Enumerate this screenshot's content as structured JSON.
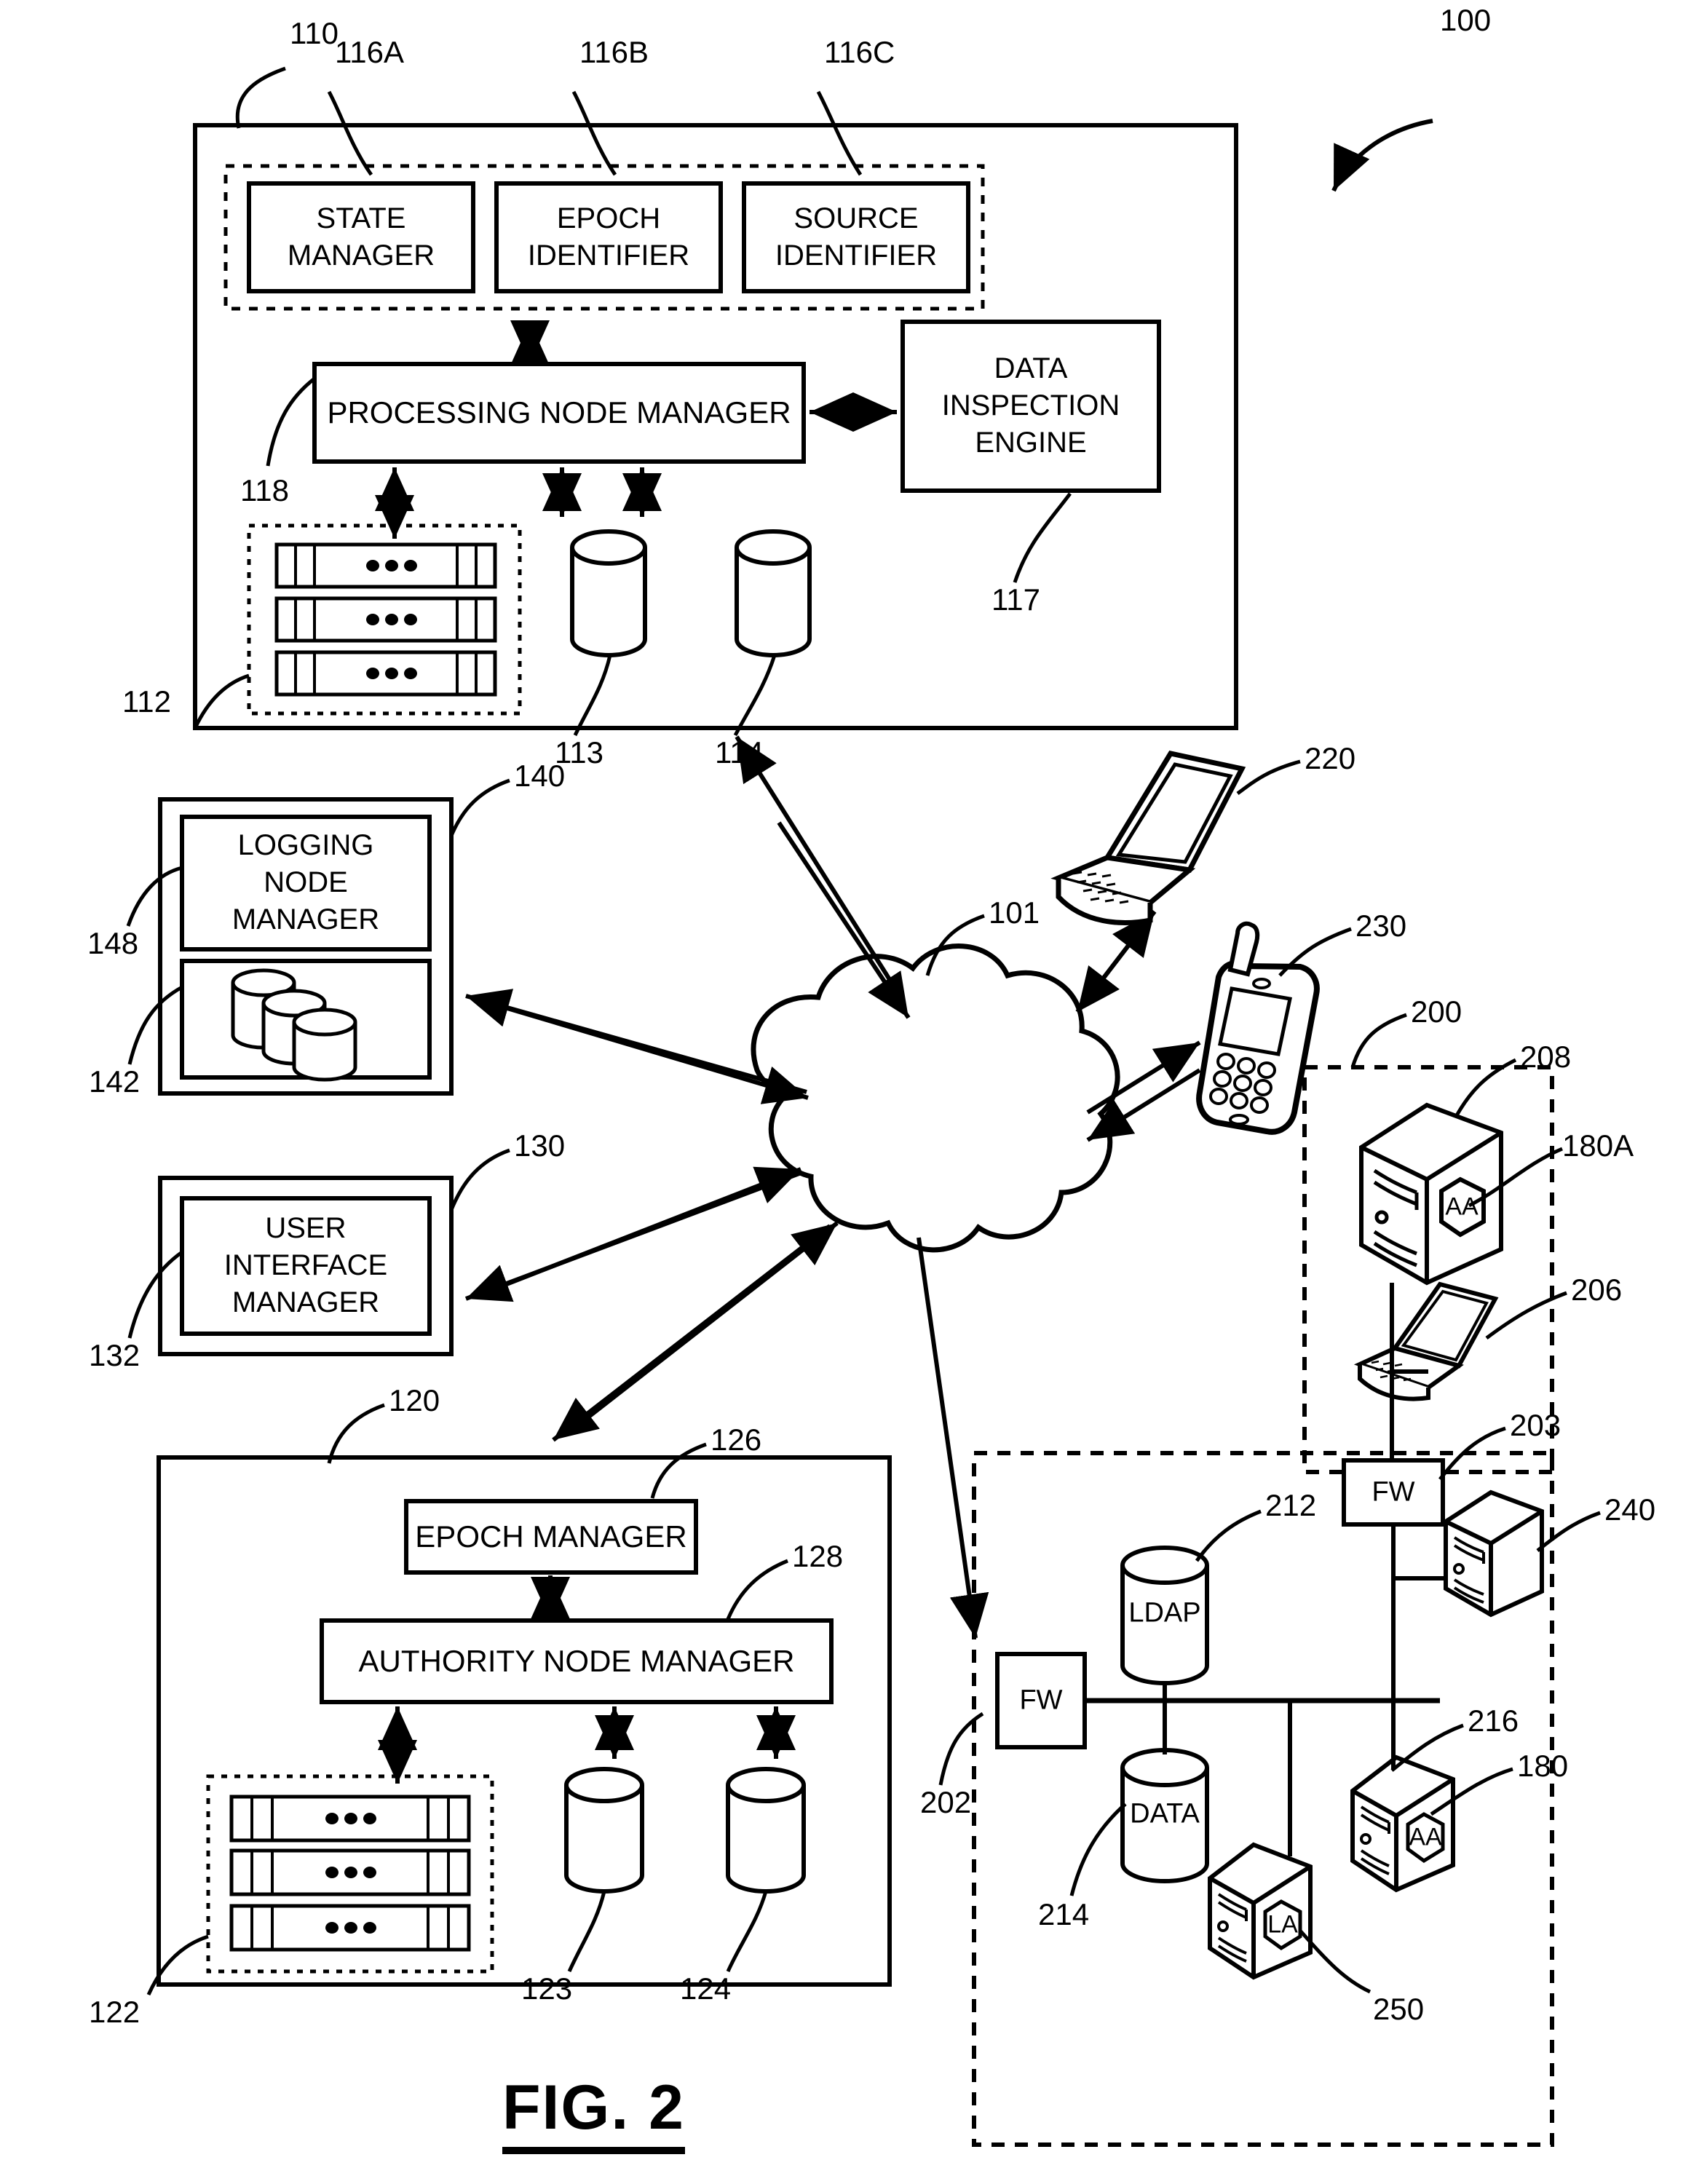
{
  "figure": {
    "caption": "FIG. 2",
    "system_ref": "100"
  },
  "processing_node": {
    "ref": "110",
    "inner_group_refs": [
      "116A",
      "116B",
      "116C"
    ],
    "modules": [
      {
        "label": "STATE\nMANAGER",
        "ref": "116A"
      },
      {
        "label": "EPOCH\nIDENTIFIER",
        "ref": "116B"
      },
      {
        "label": "SOURCE\nIDENTIFIER",
        "ref": "116C"
      }
    ],
    "manager": {
      "label": "PROCESSING NODE MANAGER",
      "ref": "118"
    },
    "inspection_engine": {
      "label": "DATA\nINSPECTION\nENGINE",
      "ref": "117"
    },
    "rack_ref": "112",
    "db_refs": [
      "113",
      "114"
    ]
  },
  "logging_node": {
    "ref": "140",
    "manager": {
      "label": "LOGGING\nNODE\nMANAGER",
      "ref": "148"
    },
    "storage_ref": "142"
  },
  "user_interface_node": {
    "ref": "130",
    "manager": {
      "label": "USER\nINTERFACE\nMANAGER",
      "ref": "132"
    }
  },
  "authority_node": {
    "ref": "120",
    "epoch_manager": {
      "label": "EPOCH MANAGER",
      "ref": "126"
    },
    "authority_manager": {
      "label": "AUTHORITY NODE MANAGER",
      "ref": "128"
    },
    "rack_ref": "122",
    "db_refs": [
      "123",
      "124"
    ]
  },
  "network": {
    "cloud_ref": "101"
  },
  "clients": {
    "laptop_ref": "220",
    "mobile_ref": "230"
  },
  "enterprise": {
    "dmz_ref": "200",
    "server_ref": "208",
    "server_badge": "AA",
    "server_badge_ref": "180A",
    "laptop_ref": "206",
    "firewall_top": {
      "label": "FW",
      "ref": "203"
    },
    "server_240_ref": "240",
    "lan_ref": "202",
    "firewall_left": {
      "label": "FW"
    },
    "ldap": {
      "label": "LDAP",
      "ref": "212"
    },
    "data": {
      "label": "DATA",
      "ref": "214"
    },
    "server_216_ref": "216",
    "server_216_badge": "AA",
    "server_216_badge_ref": "180",
    "server_250_badge": "LA",
    "server_250_ref": "250"
  },
  "colors": {
    "ink": "#000000",
    "paper": "#ffffff"
  }
}
